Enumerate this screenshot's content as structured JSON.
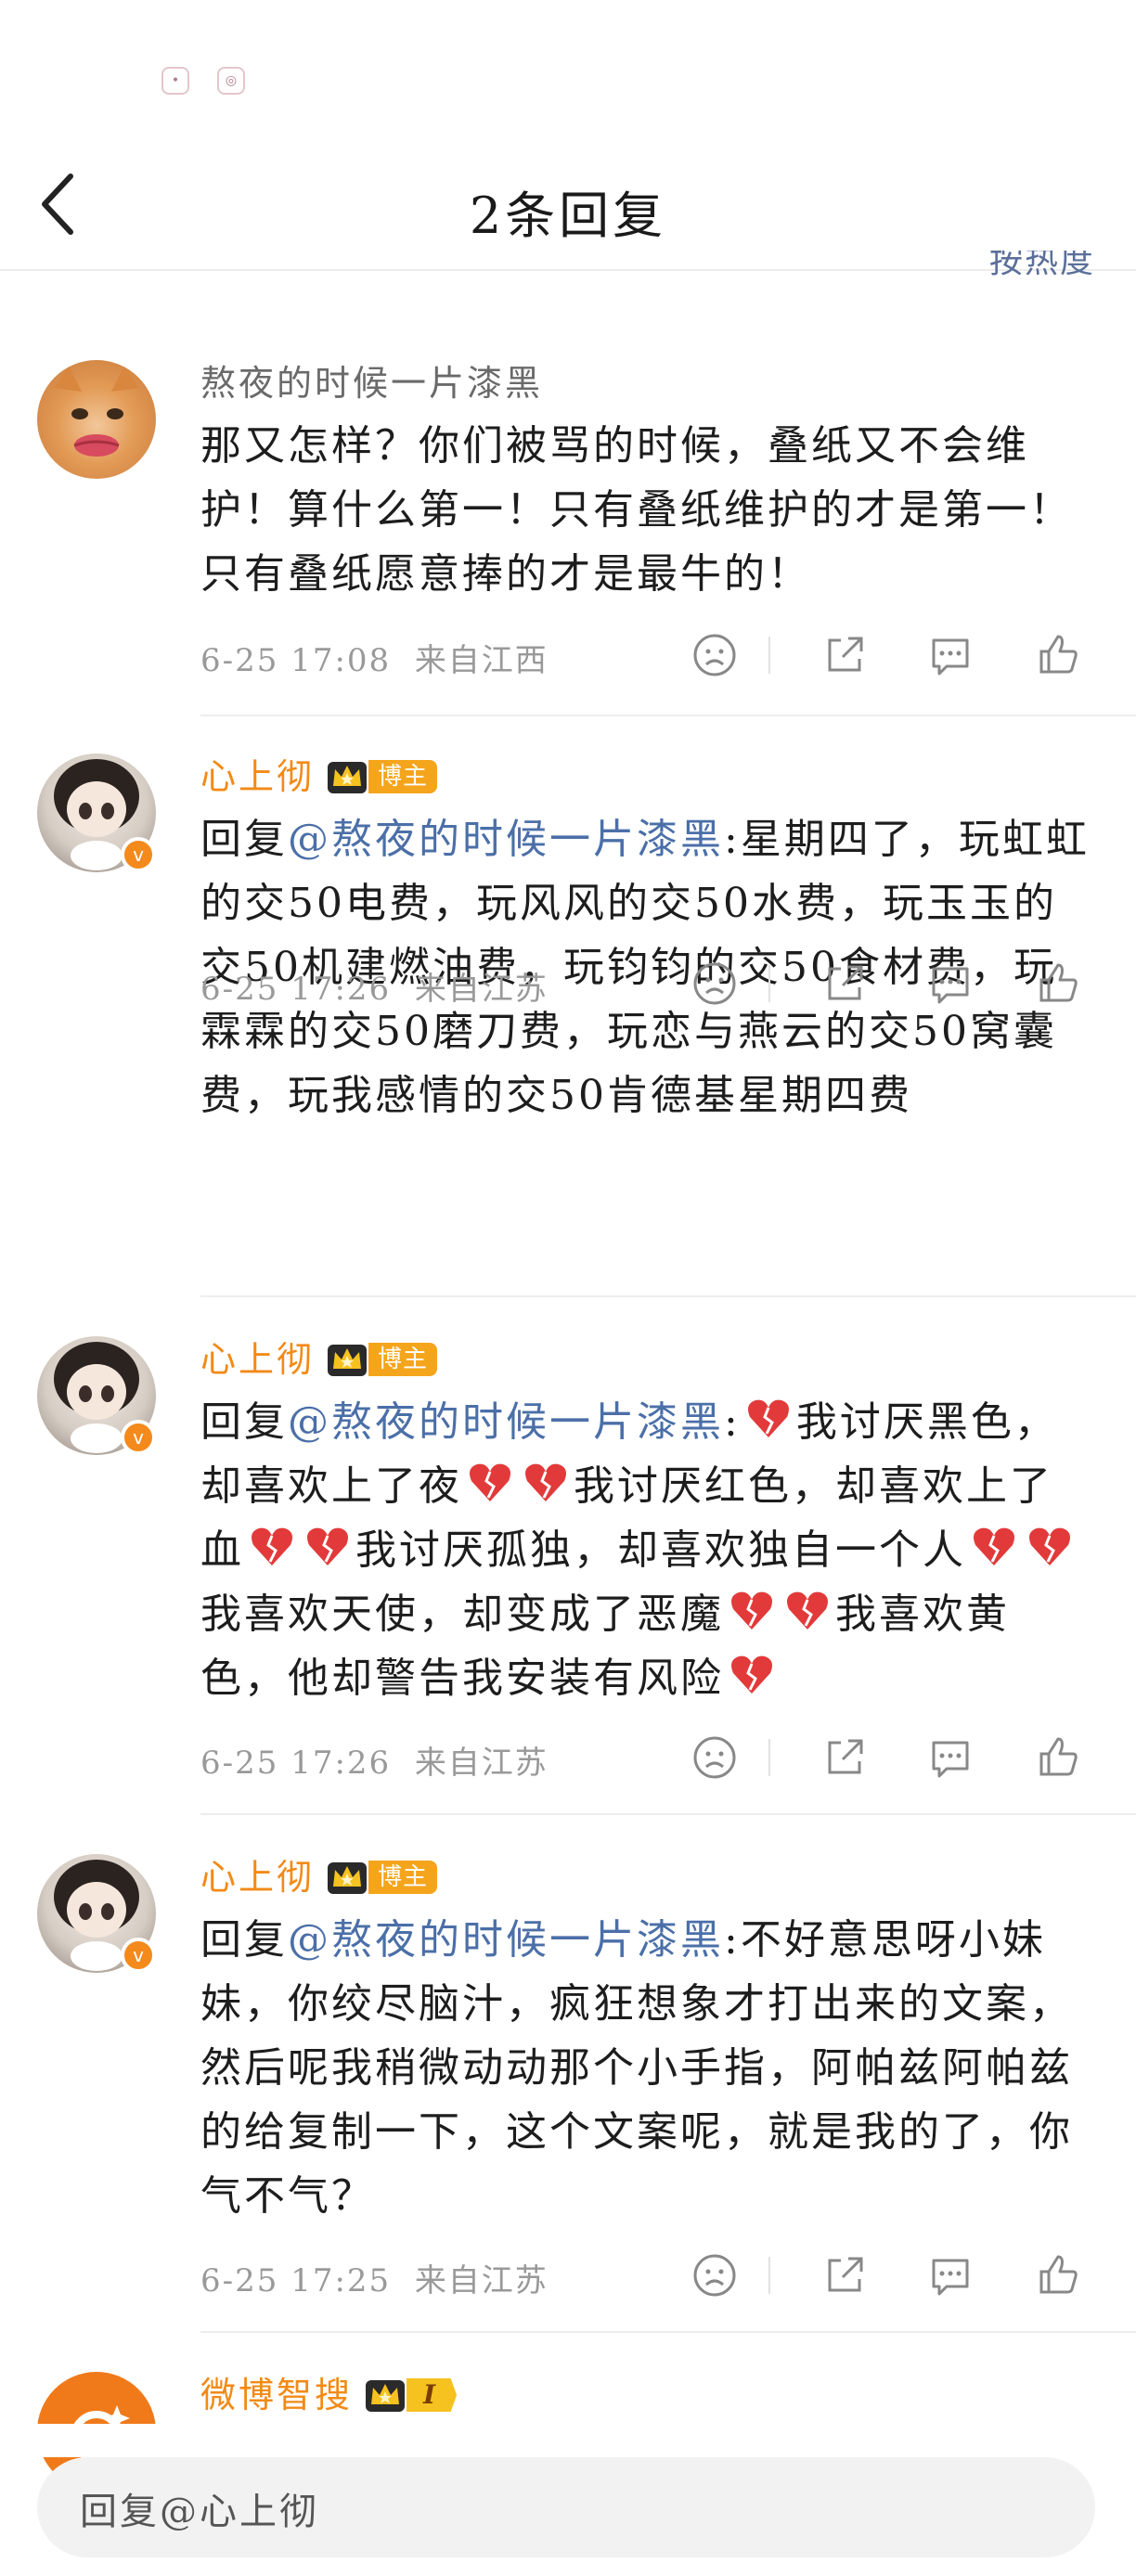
{
  "header": {
    "title": "2条回复",
    "sort_label": "按热度"
  },
  "comments": [
    {
      "username": "熬夜的时候一片漆黑",
      "username_style": "gray",
      "avatar": "orange-cat-avatar",
      "badge": null,
      "mention": "",
      "text": "那又怎样？你们被骂的时候，叠纸又不会维护！算什么第一！只有叠纸维护的才是第一！只有叠纸愿意捧的才是最牛的！",
      "timestamp": "6-25 17:08",
      "location": "来自江西"
    },
    {
      "username": "心上彻",
      "username_style": "orange",
      "avatar": "doll-avatar",
      "badge": "博主",
      "mention": "@熬夜的时候一片漆黑",
      "reply_prefix": "回复",
      "text": ":星期四了，玩虹虹的交50电费，玩风风的交50水费，玩玉玉的交50机建燃油费，玩钧钧的交50食材费，玩霖霖的交50磨刀费，玩恋与燕云的交50窝囊费，玩我感情的交50肯德基星期四费",
      "timestamp": "6-25 17:26",
      "location": "来自江苏"
    },
    {
      "username": "心上彻",
      "username_style": "orange",
      "avatar": "doll-avatar",
      "badge": "博主",
      "mention": "@熬夜的时候一片漆黑",
      "reply_prefix": "回复",
      "segments": [
        ":",
        "我讨厌黑色，却喜欢上了夜",
        "我讨厌红色，却喜欢上了血",
        "我讨厌孤独，却喜欢独自一个人",
        "我喜欢天使，却变成了恶魔",
        "我喜欢黄色，他却警告我安装有风险"
      ],
      "timestamp": "6-25 17:26",
      "location": "来自江苏"
    },
    {
      "username": "心上彻",
      "username_style": "orange",
      "avatar": "doll-avatar",
      "badge": "博主",
      "mention": "@熬夜的时候一片漆黑",
      "reply_prefix": "回复",
      "text": ":不好意思呀小妹妹，你绞尽脑汁，疯狂想象才打出来的文案，然后呢我稍微动动那个小手指，阿帕兹阿帕兹的给复制一下，这个文案呢，就是我的了，你气不气？",
      "timestamp": "6-25 17:25",
      "location": "来自江苏"
    },
    {
      "username": "微博智搜",
      "username_style": "orange",
      "avatar": "weibo-smart-search-avatar",
      "badge_level": "I"
    }
  ],
  "reply_input": {
    "placeholder": "回复@心上彻"
  },
  "colors": {
    "accent_orange": "#f28a16",
    "mention_blue": "#4b6fa8",
    "meta_gray": "#999999"
  },
  "icons": [
    "back-arrow-icon",
    "dislike-face-icon",
    "share-icon",
    "comment-icon",
    "like-thumb-icon",
    "broken-heart-icon",
    "crown-icon"
  ]
}
